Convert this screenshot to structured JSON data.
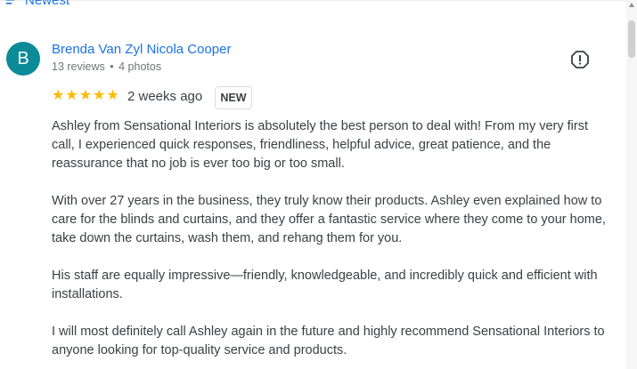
{
  "sort": {
    "label": "Newest"
  },
  "review": {
    "author_initial": "B",
    "author_name": "Brenda Van Zyl Nicola Cooper",
    "reviews_text": "13 reviews",
    "separator": "•",
    "photos_text": "4 photos",
    "rating": 5,
    "time_ago": "2 weeks ago",
    "badge": "NEW",
    "paragraphs": [
      "Ashley from Sensational Interiors is absolutely the best person to deal with! From my very first call, I experienced quick responses, friendliness, helpful advice, great patience, and the reassurance that no job is ever too big or too small.",
      "With over 27 years in the business, they truly know their products. Ashley even explained how to care for the blinds and curtains, and they offer a fantastic service where they come to your home, take down the curtains, wash them, and rehang them for you.",
      "His staff are equally impressive—friendly, knowledgeable, and incredibly quick and efficient with installations.",
      "I will most definitely call Ashley again in the future and highly recommend Sensational Interiors to anyone looking for top-quality service and products."
    ]
  },
  "colors": {
    "link_blue": "#1a73e8",
    "avatar_teal": "#0b8a98",
    "star_yellow": "#fbbc04",
    "text_dark": "#3c4043",
    "meta_gray": "#70757a"
  },
  "icons": {
    "sort": "sort-icon",
    "report": "report-alert-icon",
    "scroll_up": "chevron-up-icon",
    "star": "star-icon"
  }
}
